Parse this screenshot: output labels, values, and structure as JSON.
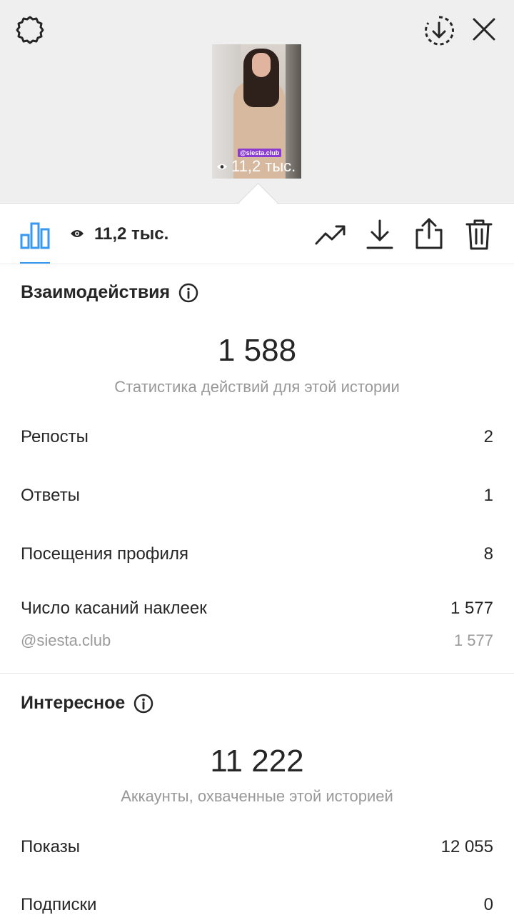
{
  "header": {
    "settings_icon": "gear-icon",
    "download_circle_icon": "download-circle-icon",
    "close_icon": "close-icon"
  },
  "preview": {
    "sticker_text": "@siesta.club",
    "views": "11,2 тыс."
  },
  "toolbar": {
    "insights_icon": "bar-chart-icon",
    "views": "11,2 тыс.",
    "icons": [
      "trend-icon",
      "download-icon",
      "share-icon",
      "trash-icon"
    ],
    "accent": "#3897f0"
  },
  "interactions": {
    "title": "Взаимодействия",
    "total": "1 588",
    "caption": "Статистика действий для этой истории",
    "rows": [
      {
        "label": "Репосты",
        "value": "2"
      },
      {
        "label": "Ответы",
        "value": "1"
      },
      {
        "label": "Посещения профиля",
        "value": "8"
      },
      {
        "label": "Число касаний наклеек",
        "value": "1 577"
      }
    ],
    "sub_row": {
      "label": "@siesta.club",
      "value": "1 577"
    }
  },
  "discovery": {
    "title": "Интересное",
    "total": "11 222",
    "caption": "Аккаунты, охваченные этой историей",
    "rows": [
      {
        "label": "Показы",
        "value": "12 055"
      },
      {
        "label": "Подписки",
        "value": "0"
      }
    ]
  }
}
